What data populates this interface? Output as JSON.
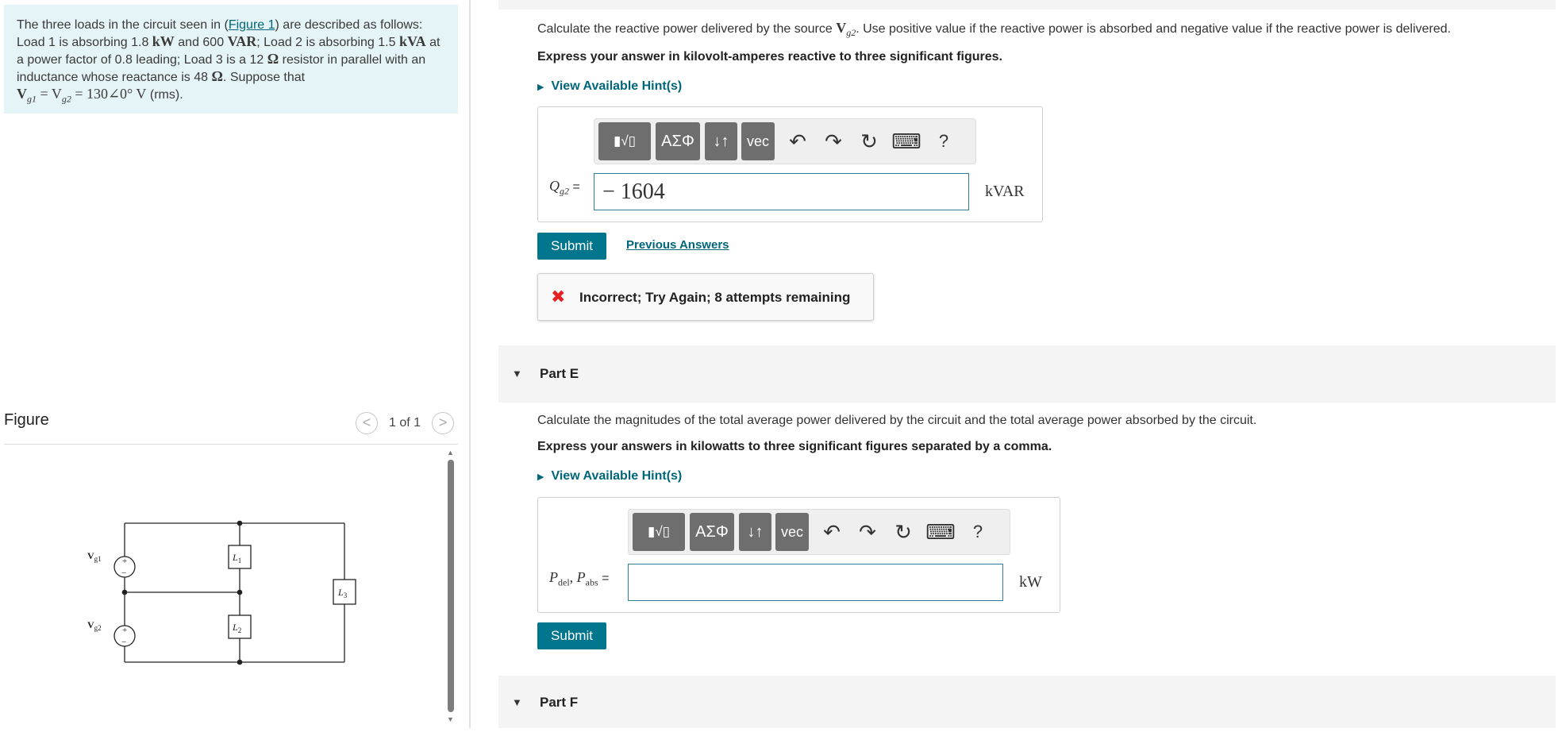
{
  "problem": {
    "text_before_link": "The three loads in the circuit seen in (",
    "figure_link": "Figure 1",
    "text_after_link": ") are described as follows: Load 1 is absorbing 1.8",
    "u_kw": "kW",
    "t_and": "and 600",
    "u_var": "VAR",
    "t_load2": "; Load 2 is absorbing 1.5",
    "u_kva": "kVA",
    "t_pf": "at a power factor of 0.8 leading; Load 3 is a 12",
    "u_ohm1": "Ω",
    "t_resistor": "resistor in parallel with an inductance whose reactance is 48",
    "u_ohm2": "Ω",
    "t_suppose": ". Suppose that",
    "equation": "V",
    "eq_sub1": "g1",
    "eq_equals": "= V",
    "eq_sub2": "g2",
    "eq_value": "= 130∠0° V",
    "t_rms": "(rms)."
  },
  "figure": {
    "title": "Figure",
    "pager": "1 of 1",
    "prev_symbol": "<",
    "next_symbol": ">",
    "labels": {
      "vg1": "V",
      "vg1_sub": "g1",
      "vg2": "V",
      "vg2_sub": "g2",
      "l1": "L",
      "l1_sub": "1",
      "l2": "L",
      "l2_sub": "2",
      "l3": "L",
      "l3_sub": "3",
      "plus": "+",
      "minus": "−"
    }
  },
  "partD": {
    "question_before": "Calculate the reactive power delivered by the source",
    "question_var": "V",
    "question_var_sub": "g2",
    "question_after": ". Use positive value if the reactive power is absorbed and negative value if the reactive power is delivered.",
    "instruction": "Express your answer in kilovolt-amperes reactive to three significant figures.",
    "hint": "View Available Hint(s)",
    "answer_label": "Q",
    "answer_label_sub": "g2",
    "answer_label_eq": "=",
    "answer_value": "− 1604",
    "unit": "kVAR",
    "submit": "Submit",
    "previous_answers": "Previous Answers",
    "feedback": "Incorrect; Try Again; 8 attempts remaining"
  },
  "partE": {
    "title": "Part E",
    "question": "Calculate the magnitudes of the total average power delivered by the circuit and the total average power absorbed by the circuit.",
    "instruction": "Express your answers in kilowatts to three significant figures separated by a comma.",
    "hint": "View Available Hint(s)",
    "answer_label_a": "P",
    "answer_label_a_sub": "del",
    "answer_label_sep": ", ",
    "answer_label_b": "P",
    "answer_label_b_sub": "abs",
    "answer_label_eq": "=",
    "answer_value": "",
    "unit": "kW",
    "submit": "Submit"
  },
  "partF": {
    "title": "Part F"
  },
  "toolbar": {
    "templates": "▮√▯",
    "greek": "ΑΣΦ",
    "arrows": "↓↑",
    "vec": "vec",
    "undo": "↶",
    "redo": "↷",
    "reset": "↻",
    "keyboard": "⌨",
    "help": "?"
  },
  "icons": {
    "hint_caret": "▶",
    "part_caret": "▼",
    "feedback": "✖",
    "scroll_up": "▲",
    "scroll_down": "▼"
  }
}
